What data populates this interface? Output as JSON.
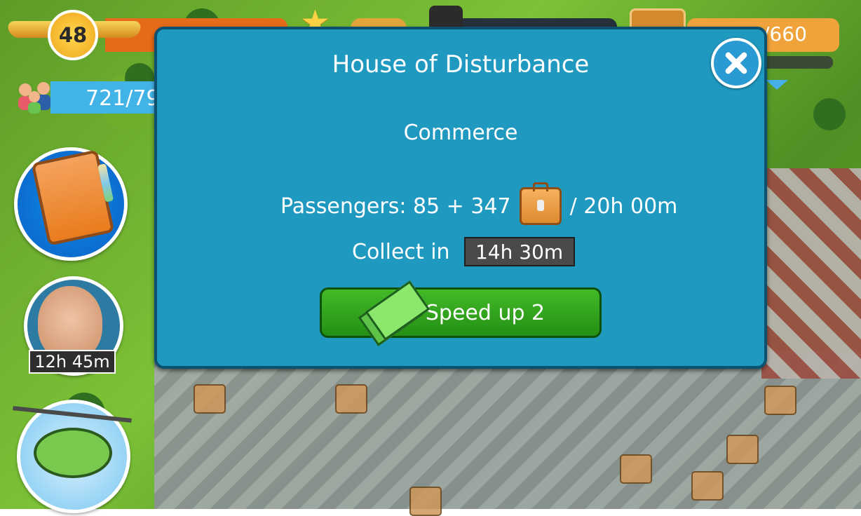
{
  "topbar": {
    "level": "48",
    "cargo_count": "/660",
    "passengers": "721/79"
  },
  "left_panel": {
    "timer": "12h 45m"
  },
  "modal": {
    "title": "House of Disturbance",
    "category": "Commerce",
    "passengers_text": "Passengers: 85 + 347",
    "passengers_time": "/ 20h 00m",
    "collect_label": "Collect in",
    "collect_time": "14h 30m",
    "speed_up_label": "Speed up 2"
  },
  "icons": {
    "wings_icon": "wings-icon",
    "star_icon": "star-icon",
    "barrel_icon": "barrel-icon",
    "suitcase_icon": "suitcase-icon",
    "people_icon": "people-icon",
    "book_icon": "book-icon",
    "money_icon": "money-icon",
    "close_icon": "close-icon",
    "helicopter_icon": "helicopter-icon"
  }
}
